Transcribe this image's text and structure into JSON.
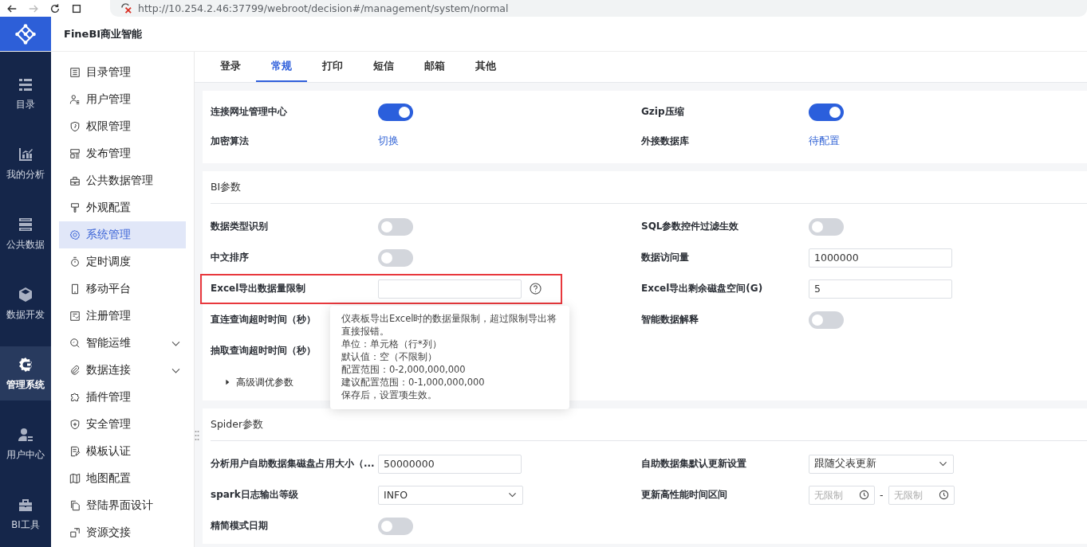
{
  "browser": {
    "url": "http://10.254.2.46:37799/webroot/decision#/management/system/normal"
  },
  "header": {
    "title": "FineBI商业智能"
  },
  "rail": [
    {
      "label": "目录",
      "selected": false
    },
    {
      "label": "我的分析",
      "selected": false
    },
    {
      "label": "公共数据",
      "selected": false
    },
    {
      "label": "数据开发",
      "selected": false
    },
    {
      "label": "管理系统",
      "selected": true
    },
    {
      "label": "用户中心",
      "selected": false
    },
    {
      "label": "BI工具",
      "selected": false
    }
  ],
  "sidebar": [
    {
      "label": "目录管理",
      "selected": false,
      "has_submenu": false
    },
    {
      "label": "用户管理",
      "selected": false,
      "has_submenu": false
    },
    {
      "label": "权限管理",
      "selected": false,
      "has_submenu": false
    },
    {
      "label": "发布管理",
      "selected": false,
      "has_submenu": false
    },
    {
      "label": "公共数据管理",
      "selected": false,
      "has_submenu": false
    },
    {
      "label": "外观配置",
      "selected": false,
      "has_submenu": false
    },
    {
      "label": "系统管理",
      "selected": true,
      "has_submenu": false
    },
    {
      "label": "定时调度",
      "selected": false,
      "has_submenu": false
    },
    {
      "label": "移动平台",
      "selected": false,
      "has_submenu": false
    },
    {
      "label": "注册管理",
      "selected": false,
      "has_submenu": false
    },
    {
      "label": "智能运维",
      "selected": false,
      "has_submenu": true
    },
    {
      "label": "数据连接",
      "selected": false,
      "has_submenu": true
    },
    {
      "label": "插件管理",
      "selected": false,
      "has_submenu": false
    },
    {
      "label": "安全管理",
      "selected": false,
      "has_submenu": false
    },
    {
      "label": "模板认证",
      "selected": false,
      "has_submenu": false
    },
    {
      "label": "地图配置",
      "selected": false,
      "has_submenu": false
    },
    {
      "label": "登陆界面设计",
      "selected": false,
      "has_submenu": false
    },
    {
      "label": "资源交接",
      "selected": false,
      "has_submenu": false
    }
  ],
  "tabs": [
    {
      "label": "登录",
      "selected": false
    },
    {
      "label": "常规",
      "selected": true
    },
    {
      "label": "打印",
      "selected": false
    },
    {
      "label": "短信",
      "selected": false
    },
    {
      "label": "邮箱",
      "selected": false
    },
    {
      "label": "其他",
      "selected": false
    }
  ],
  "sections": [
    {
      "rows": [
        [
          {
            "label": "连接网址管理中心",
            "kind": "toggle",
            "on": true
          },
          {
            "label": "Gzip压缩",
            "kind": "toggle",
            "on": true
          }
        ],
        [
          {
            "label": "加密算法",
            "kind": "link",
            "value": "切换"
          },
          {
            "label": "外接数据库",
            "kind": "link",
            "value": "待配置"
          }
        ]
      ]
    },
    {
      "title": "BI参数",
      "rows": [
        [
          {
            "label": "数据类型识别",
            "kind": "toggle",
            "on": false
          },
          {
            "label": "SQL参数控件过滤生效",
            "kind": "toggle",
            "on": false
          }
        ],
        [
          {
            "label": "中文排序",
            "kind": "toggle",
            "on": false
          },
          {
            "label": "数据访问量",
            "kind": "input",
            "value": "1000000"
          }
        ],
        [
          {
            "label": "Excel导出数据量限制",
            "kind": "input",
            "highlighted": true,
            "help": true
          },
          {
            "label": "Excel导出剩余磁盘空间(G)",
            "kind": "input",
            "value": "5"
          }
        ],
        [
          {
            "label": "直连查询超时时间（秒）"
          },
          {
            "label": "智能数据解释",
            "kind": "toggle",
            "on": false
          }
        ],
        [
          {
            "label": "抽取查询超时时间（秒）"
          }
        ]
      ],
      "advanced": {
        "label": "高级调优参数",
        "expanded": false
      },
      "tooltip": [
        "仪表板导出Excel时的数据量限制，超过限制导出将直接报错。",
        "单位：单元格（行*列）",
        "默认值：空（不限制）",
        "配置范围：0-2,000,000,000",
        "建议配置范围：0-1,000,000,000",
        "保存后，设置项生效。"
      ]
    },
    {
      "title": "Spider参数",
      "rows": [
        [
          {
            "label": "分析用户自助数据集磁盘占用大小（...",
            "kind": "input",
            "value": "50000000"
          },
          {
            "label": "自助数据集默认更新设置",
            "kind": "select",
            "value": "跟随父表更新"
          }
        ],
        [
          {
            "label": "spark日志输出等级",
            "kind": "select",
            "value": "INFO"
          },
          {
            "label": "更新高性能时间区间",
            "kind": "timerange",
            "from": {
              "placeholder": "无限制"
            },
            "separator": "-",
            "to": {
              "placeholder": "无限制"
            }
          }
        ],
        [
          {
            "label": "精简模式日期",
            "kind": "toggle",
            "on": false
          }
        ]
      ]
    }
  ]
}
